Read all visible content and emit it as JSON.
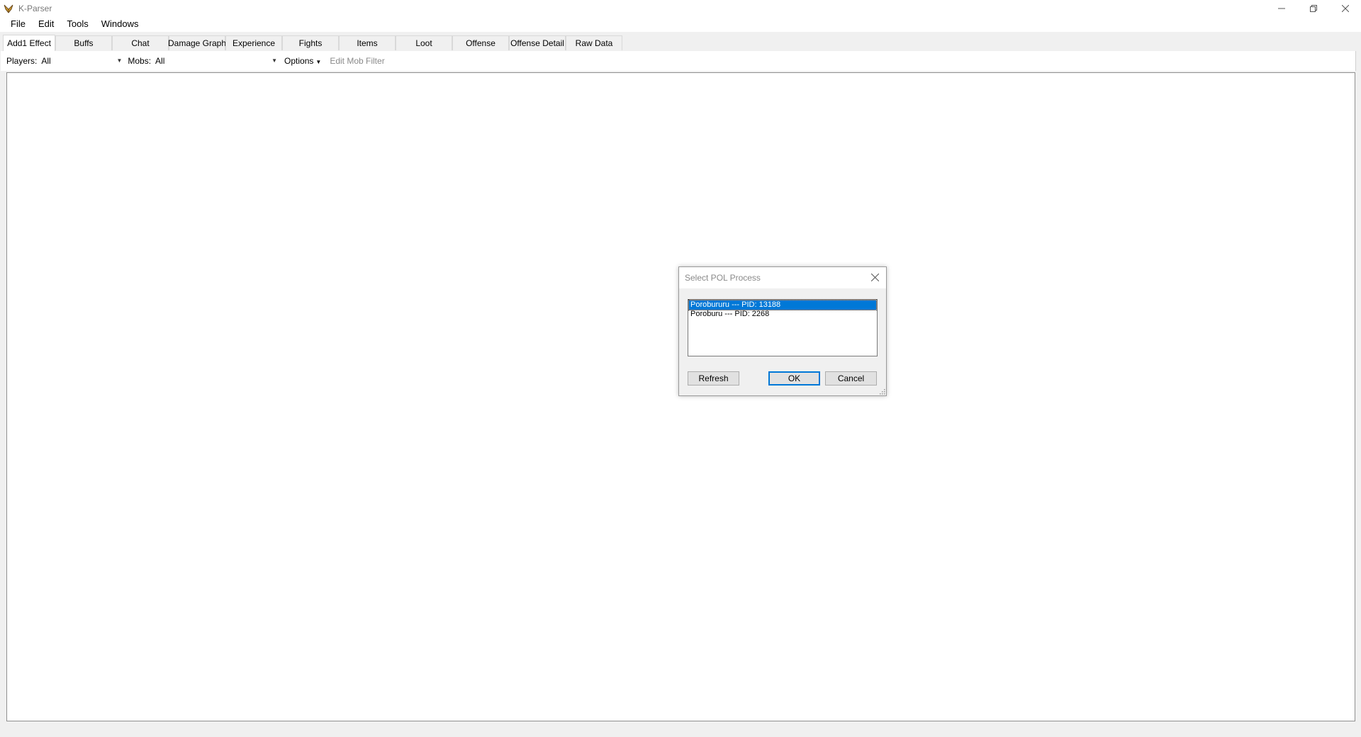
{
  "window": {
    "title": "K-Parser",
    "icon": "feather-icon",
    "controls": [
      "minimize",
      "restore",
      "close"
    ]
  },
  "menu": {
    "items": [
      "File",
      "Edit",
      "Tools",
      "Windows"
    ]
  },
  "tabs": {
    "items": [
      "Add1 Effect",
      "Buffs",
      "Chat",
      "Damage Graph",
      "Experience",
      "Fights",
      "Items",
      "Loot",
      "Offense",
      "Offense Detail",
      "Raw Data"
    ],
    "active": "Add1 Effect"
  },
  "filters": {
    "players_label": "Players:",
    "players_value": "All",
    "mobs_label": "Mobs:",
    "mobs_value": "All",
    "options_label": "Options",
    "edit_mob_filter": "Edit Mob Filter"
  },
  "dialog": {
    "title": "Select POL Process",
    "processes": [
      "Porobururu --- PID: 13188",
      "Poroburu --- PID: 2268"
    ],
    "selected_index": 0,
    "buttons": {
      "refresh": "Refresh",
      "ok": "OK",
      "cancel": "Cancel"
    }
  },
  "colors": {
    "selection": "#0078d7",
    "chrome": "#f0f0f0"
  }
}
